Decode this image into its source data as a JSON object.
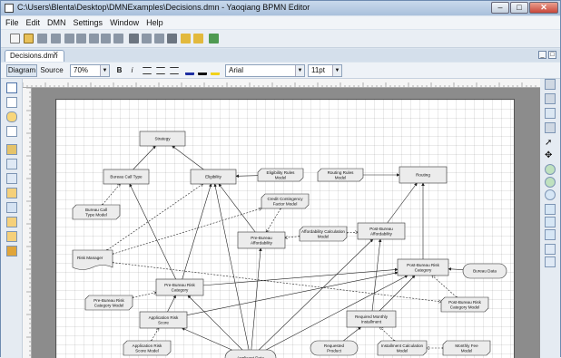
{
  "window": {
    "title": "C:\\Users\\Blenta\\Desktop\\DMNExamples\\Decisions.dmn - Yaoqiang BPMN Editor"
  },
  "menu": [
    "File",
    "Edit",
    "DMN",
    "Settings",
    "Window",
    "Help"
  ],
  "tab": {
    "label": "Decisions.dmn"
  },
  "format": {
    "diagram_label": "Diagram",
    "source_label": "Source",
    "zoom": "70%",
    "bold": "B",
    "italic": "i",
    "font": "Arial",
    "size": "11pt"
  },
  "nodes": [
    {
      "label": "Strategy",
      "type": "decision"
    },
    {
      "label": "Bureau Call Type",
      "type": "decision"
    },
    {
      "label": "Eligibility",
      "type": "decision"
    },
    {
      "label": "Eligibility Rules Model",
      "type": "bkm"
    },
    {
      "label": "Routing Rules Model",
      "type": "bkm"
    },
    {
      "label": "Routing",
      "type": "decision"
    },
    {
      "label": "Credit Contingency Factor Model",
      "type": "bkm"
    },
    {
      "label": "Bureau Call Type Model",
      "type": "bkm"
    },
    {
      "label": "Affordability Calculation Model",
      "type": "bkm"
    },
    {
      "label": "Pre-Bureau Affordability",
      "type": "decision"
    },
    {
      "label": "Post-Bureau Affordability",
      "type": "decision"
    },
    {
      "label": "Risk Manager",
      "type": "source"
    },
    {
      "label": "Post-Bureau Risk Category",
      "type": "decision"
    },
    {
      "label": "Bureau Data",
      "type": "data"
    },
    {
      "label": "Pre-Bureau Risk Category",
      "type": "decision"
    },
    {
      "label": "Pre-Bureau Risk Category Model",
      "type": "bkm"
    },
    {
      "label": "Post-Bureau Risk Category Model",
      "type": "bkm"
    },
    {
      "label": "Application Risk Score",
      "type": "decision"
    },
    {
      "label": "Required Monthly Installment",
      "type": "decision"
    },
    {
      "label": "Application Risk Score Model",
      "type": "bkm"
    },
    {
      "label": "Requested Product",
      "type": "data"
    },
    {
      "label": "Installment Calculation Model",
      "type": "bkm"
    },
    {
      "label": "Monthly Fee Model",
      "type": "bkm"
    },
    {
      "label": "Applicant Data",
      "type": "data"
    }
  ]
}
